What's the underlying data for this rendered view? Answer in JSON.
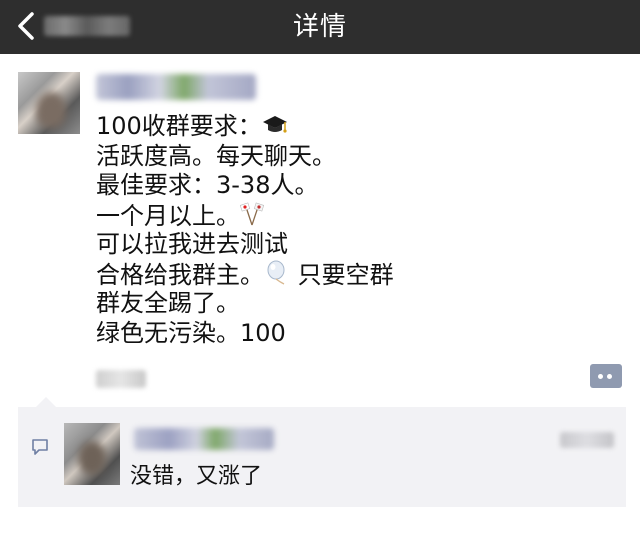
{
  "navbar": {
    "back_label": "发现",
    "title": "详情"
  },
  "post": {
    "author_name": "",
    "lines": [
      "100收群要求：",
      "活跃度高。每天聊天。",
      "最佳要求：3-38人。",
      "一个月以上。",
      "可以拉我进去测试",
      "合格给我群主。",
      "群友全踢了。",
      "绿色无污染。100"
    ],
    "line6_suffix": " 只要空群",
    "emojis": [
      "graduation-cap",
      "crossed-flags",
      "balloon"
    ],
    "timestamp": ""
  },
  "comments": [
    {
      "author": "",
      "text": "没错，又涨了",
      "time": ""
    }
  ],
  "colors": {
    "navbar_bg": "#2e2e2e",
    "comment_bg": "#f2f2f5",
    "action_btn": "#8f9ab0"
  }
}
